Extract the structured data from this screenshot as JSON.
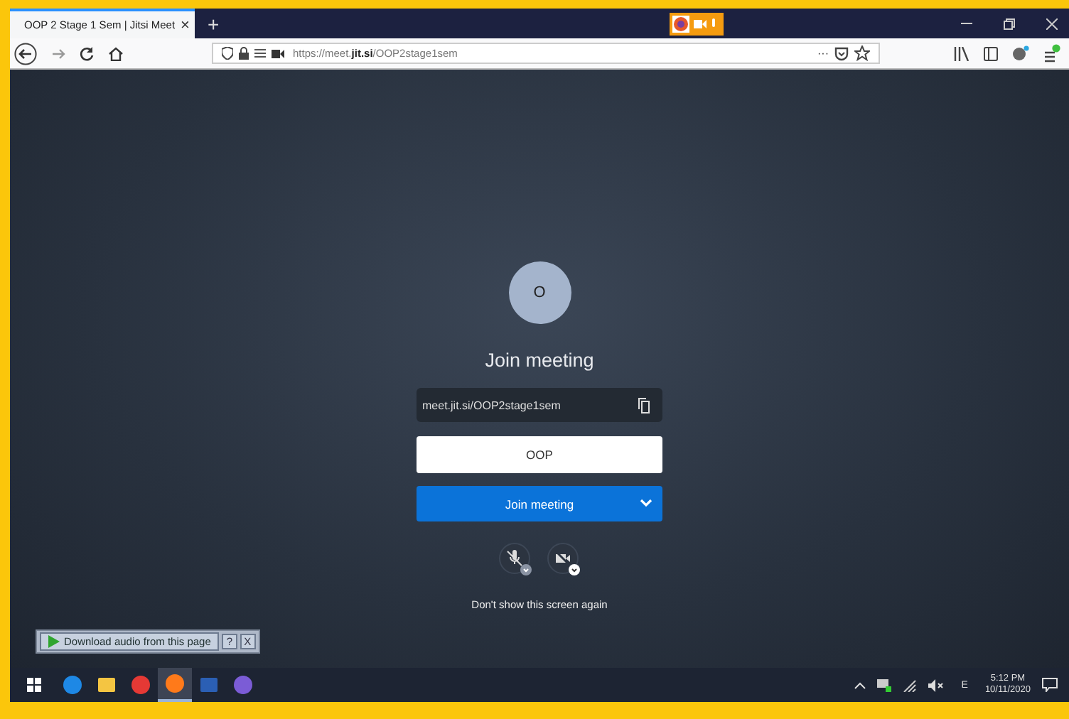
{
  "browser": {
    "tab_title": "OOP 2 Stage 1 Sem | Jitsi Meet",
    "tab_close": "×",
    "new_tab": "+",
    "url_prefix": "https://meet.",
    "url_domain": "jit.si",
    "url_path": "/OOP2stage1sem",
    "url_more": "···"
  },
  "prejoin": {
    "avatar_initial": "O",
    "heading": "Join meeting",
    "meeting_link": "meet.jit.si/OOP2stage1sem",
    "name_value": "OOP",
    "join_label": "Join meeting",
    "dont_show": "Don't show this screen again"
  },
  "download_bar": {
    "label": "Download audio from this page",
    "help": "?",
    "close": "X"
  },
  "taskbar": {
    "apps": [
      {
        "kind": "edge",
        "selected": false
      },
      {
        "kind": "explorer",
        "selected": false
      },
      {
        "kind": "chrome",
        "selected": false
      },
      {
        "kind": "firefox",
        "selected": true
      },
      {
        "kind": "word",
        "selected": false
      },
      {
        "kind": "viber",
        "selected": false
      }
    ],
    "language": "E",
    "time": "5:12 PM",
    "date": "10/11/2020"
  }
}
